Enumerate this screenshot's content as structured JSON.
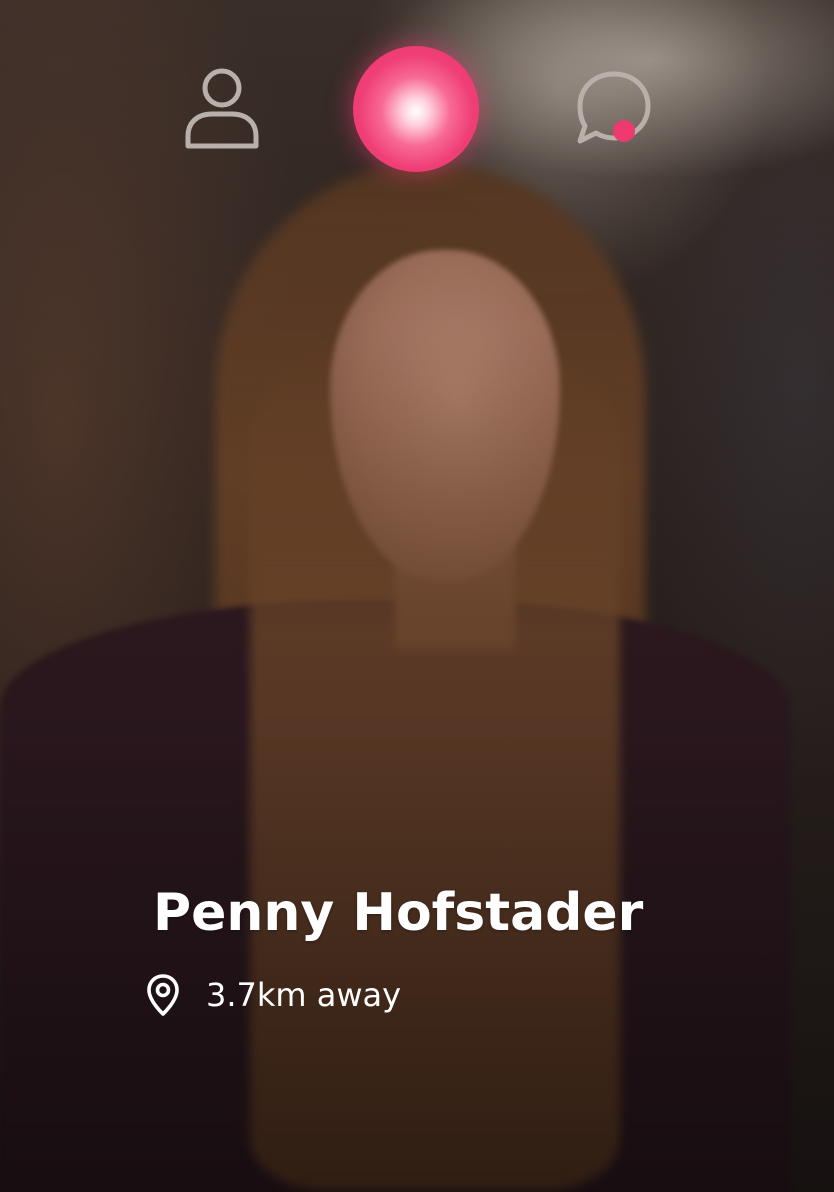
{
  "nav": {
    "profile_icon": "user-icon",
    "home_icon": "glowing-orb",
    "chat_icon": "chat-bubble-icon",
    "chat_has_notification": true,
    "accent_color": "#ee3a6e",
    "inactive_icon_color": "#b9b0ab"
  },
  "profile": {
    "name": "Penny Hofstader",
    "distance": "3.7km away",
    "location_icon": "location-pin-icon"
  }
}
